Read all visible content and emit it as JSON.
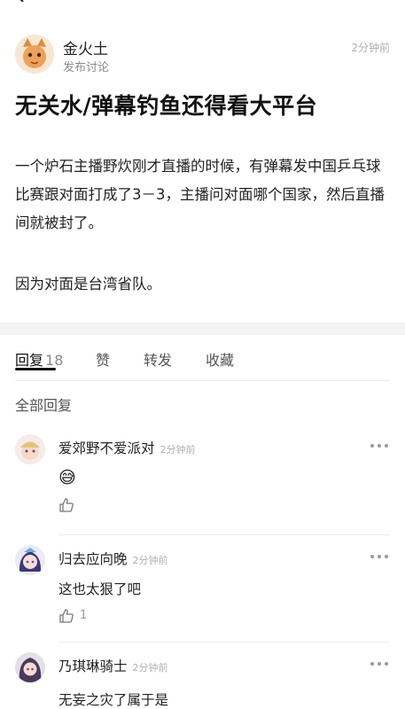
{
  "post": {
    "author": "金火土",
    "subtitle": "发布讨论",
    "time": "2分钟前",
    "title": "无关水/弹幕钓鱼还得看大平台",
    "paragraphs": [
      "一个炉石主播野炊刚才直播的时候，有弹幕发中国乒乓球比赛跟对面打成了3－3，主播问对面哪个国家，然后直播间就被封了。",
      "因为对面是台湾省队。"
    ]
  },
  "tabs": {
    "reply_label": "回复",
    "reply_count": "18",
    "like_label": "赞",
    "share_label": "转发",
    "favorite_label": "收藏"
  },
  "replies_header": "全部回复",
  "comments": [
    {
      "name": "爱郊野不爱派对",
      "time": "2分钟前",
      "text": "😅",
      "likes": ""
    },
    {
      "name": "归去应向晚",
      "time": "2分钟前",
      "text": "这也太狠了吧",
      "likes": "1"
    },
    {
      "name": "乃琪琳骑士",
      "time": "2分钟前",
      "text": "无妄之灾了属于是",
      "likes": ""
    }
  ],
  "icons": {
    "back": "chevron-left-icon",
    "more": "more-dots-icon",
    "like": "thumbs-up-icon"
  }
}
